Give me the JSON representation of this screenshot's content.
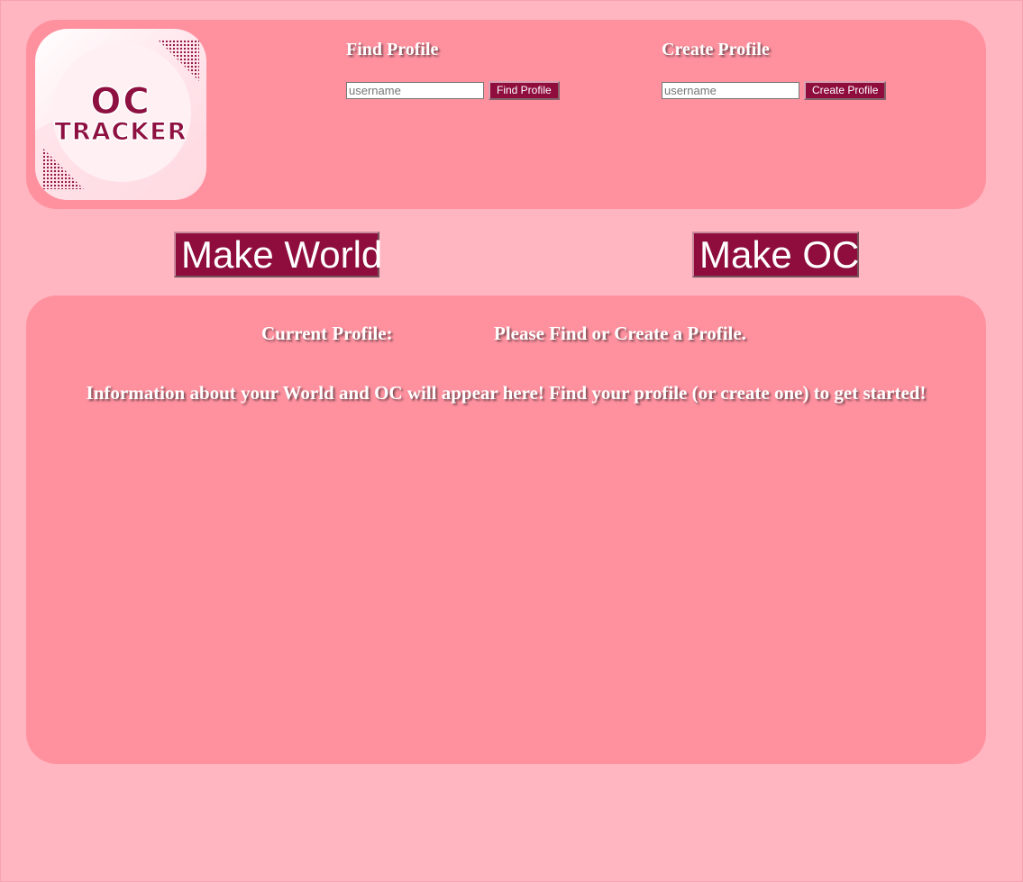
{
  "logo": {
    "line1": "OC",
    "line2": "TRACKER"
  },
  "find_profile": {
    "title": "Find Profile",
    "placeholder": "username",
    "button_label": "Find Profile"
  },
  "create_profile": {
    "title": "Create Profile",
    "placeholder": "username",
    "button_label": "Create Profile"
  },
  "actions": {
    "make_world_label": "Make World",
    "make_oc_label": "Make OC"
  },
  "profile_info": {
    "current_label": "Current Profile:",
    "current_value": "Please Find or Create a Profile.",
    "message": "Information about your World and OC will appear here! Find your profile (or create one) to get started!"
  },
  "colors": {
    "page_background": "#ffb6c1",
    "panel_background": "#ff919f",
    "button_background": "#8e0d3c",
    "text_color": "#ffffff"
  }
}
